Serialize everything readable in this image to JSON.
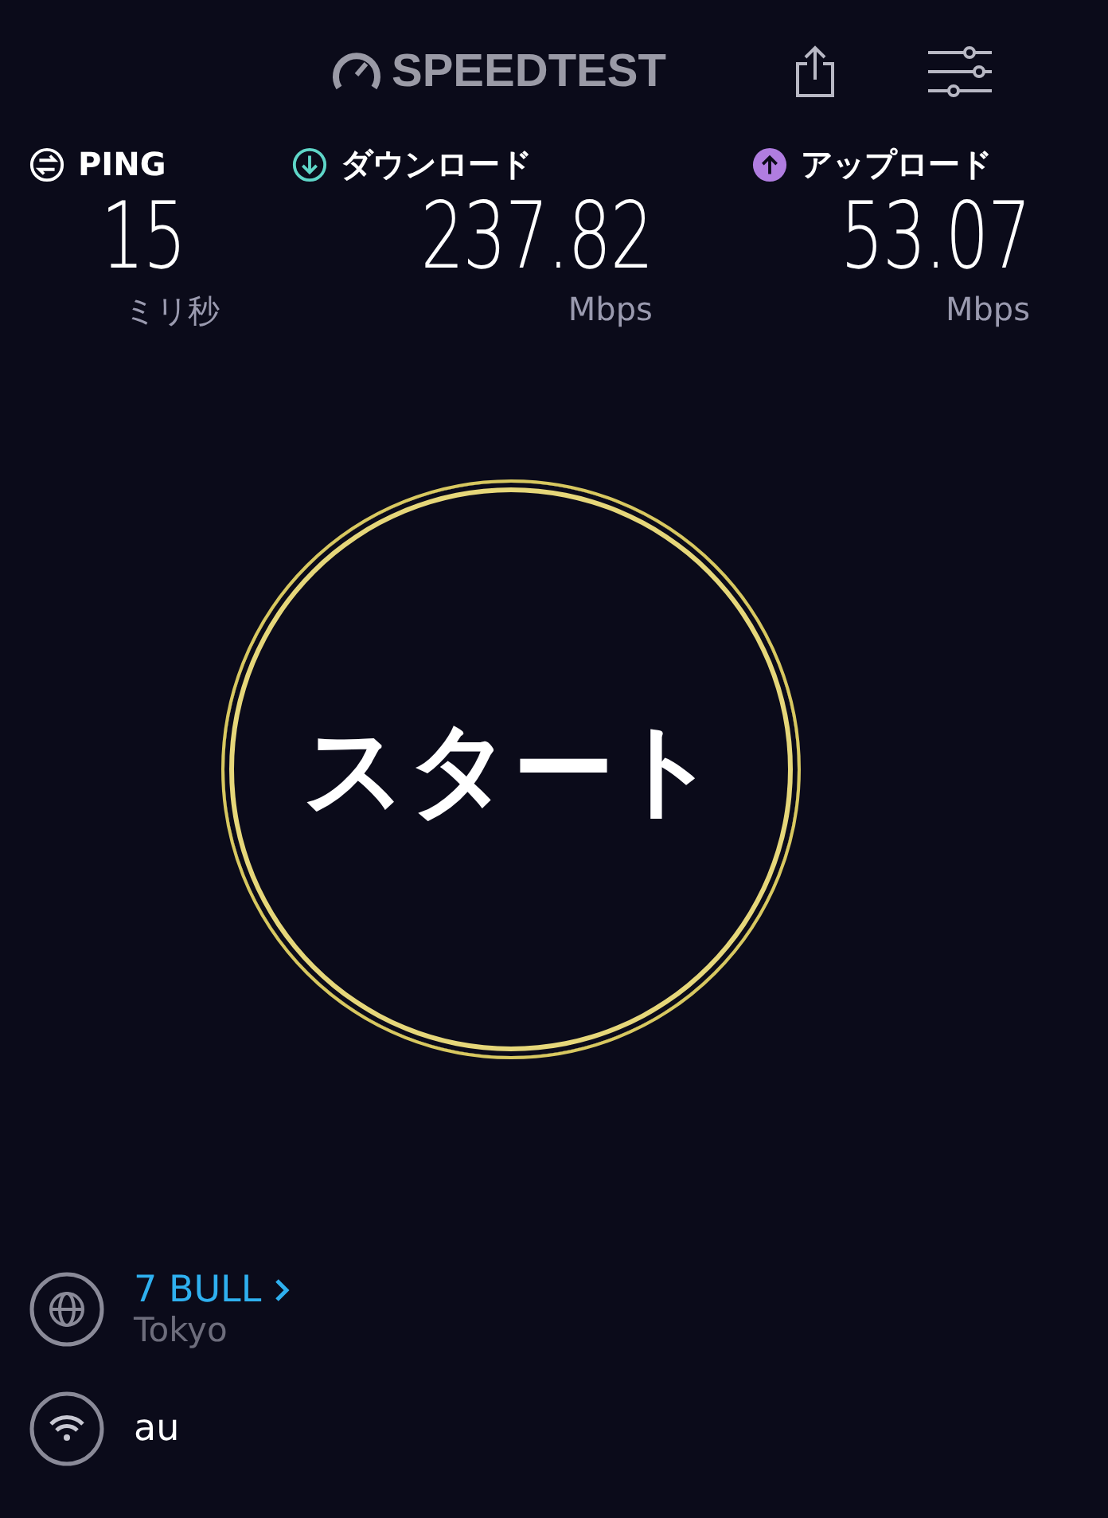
{
  "header": {
    "logo": "SPEEDTEST"
  },
  "metrics": [
    {
      "kind": "ping",
      "label": "PING",
      "value": "15",
      "unit": "ミリ秒",
      "color": "#ffffff"
    },
    {
      "kind": "download",
      "label": "ダウンロード",
      "value": "237.82",
      "unit": "Mbps",
      "color": "#5fd6c8"
    },
    {
      "kind": "upload",
      "label": "アップロード",
      "value": "53.07",
      "unit": "Mbps",
      "color": "#b07de0"
    }
  ],
  "start_button": {
    "label": "スタート"
  },
  "server": {
    "name": "7 BULL",
    "location": "Tokyo"
  },
  "network": {
    "name": "au"
  }
}
